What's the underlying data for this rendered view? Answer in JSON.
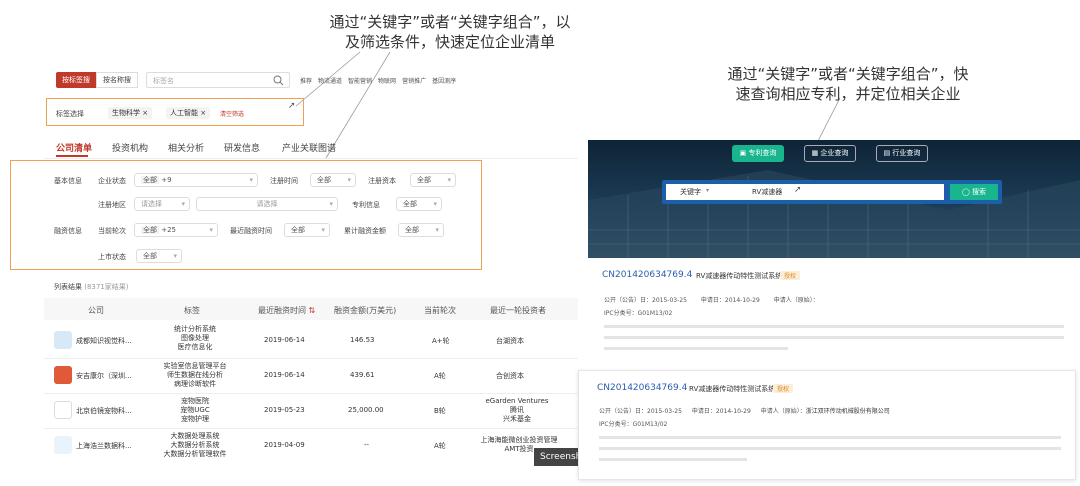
{
  "annotations": {
    "left": [
      "通过“关键字”或者“关键字组合”，以",
      "及筛选条件，快速定位企业清单"
    ],
    "right": [
      "通过“关键字”或者“关键字组合”，快",
      "速查询相应专利，并定位相关企业"
    ]
  },
  "left": {
    "search_tabs": [
      "按标签搜",
      "按名称搜"
    ],
    "search_placeholder": "标签名",
    "quick_links": [
      "推荐",
      "物流通道",
      "智能营销",
      "物联网",
      "营销推广",
      "基因测序"
    ],
    "tag_select_label": "标签选择",
    "tags": [
      "生物科学",
      "人工智能"
    ],
    "tag_clear": "清空筛选",
    "tabs": [
      "公司清单",
      "投资机构",
      "相关分析",
      "研发信息",
      "产业关联图谱"
    ],
    "filters": {
      "basic_info": "基本信息",
      "company_status": "企业状态",
      "status_value": "全部",
      "status_count": "+9",
      "reg_time": "注册时间",
      "reg_time_value": "全部",
      "reg_capital": "注册资本",
      "reg_capital_value": "全部",
      "reg_region": "注册地区",
      "region_placeholder_1": "请选择",
      "region_placeholder_2": "请选择",
      "patent_info": "专利信息",
      "patent_value": "全部",
      "financing_info": "融资信息",
      "current_round": "当前轮次",
      "round_value": "全部",
      "round_count": "+25",
      "recent_financing_time": "最近融资时间",
      "recent_time_value": "全部",
      "total_financing": "累计融资金额",
      "total_value": "全部",
      "listing_status": "上市状态",
      "listing_value": "全部"
    },
    "list_result": "列表结果",
    "list_count": "(8371家结果)",
    "table_headers": [
      "公司",
      "标签",
      "最近融资时间",
      "融资金额(万美元)",
      "当前轮次",
      "最近一轮投资者"
    ],
    "rows": [
      {
        "company": "成都知识视觉科...",
        "tags": [
          "统计分析系统",
          "图像处理",
          "医疗信息化"
        ],
        "date": "2019-06-14",
        "amount": "146.53",
        "round": "A+轮",
        "investors": [
          "台湖资本"
        ]
      },
      {
        "company": "安吉康尔（深圳...",
        "tags": [
          "实验室信息管理平台",
          "师生数据在线分析",
          "病理诊断软件"
        ],
        "date": "2019-06-14",
        "amount": "439.61",
        "round": "A轮",
        "investors": [
          "合创资本"
        ]
      },
      {
        "company": "北京伯镜宠物科...",
        "tags": [
          "宠物医院",
          "宠物UGC",
          "宠物护理"
        ],
        "date": "2019-05-23",
        "amount": "25,000.00",
        "round": "B轮",
        "investors": [
          "eGarden Ventures",
          "腾讯",
          "兴禾基金"
        ]
      },
      {
        "company": "上海浩兰数据科...",
        "tags": [
          "大数据处理系统",
          "大数据分析系统",
          "大数据分析管理软件"
        ],
        "date": "2019-04-09",
        "amount": "--",
        "round": "A轮",
        "investors": [
          "上海海能微创业投资管理",
          "AMT投资"
        ]
      }
    ],
    "screenshot_badge": "Screensh"
  },
  "right": {
    "tabs": [
      "专利查询",
      "企业查询",
      "行业查询"
    ],
    "search_type": "关键字",
    "search_value": "RV减速器",
    "search_button": "搜索",
    "results": [
      {
        "number": "CN201420634769.4",
        "title": "RV减速器传动特性测试系统",
        "badge": "授权",
        "meta_label_1": "公开（公告）日：",
        "meta_value_1": "2015-03-25",
        "meta_label_2": "申请日：",
        "meta_value_2": "2014-10-29",
        "meta_label_3": "申请人（原始）：",
        "meta_value_3": "",
        "ipc_label": "IPC分类号：",
        "ipc_value": "G01M13/02"
      },
      {
        "number": "CN201420634769.4",
        "title": "RV减速器传动特性测试系统",
        "badge": "授权",
        "meta_label_1": "公开（公告）日：",
        "meta_value_1": "2015-03-25",
        "meta_label_2": "申请日：",
        "meta_value_2": "2014-10-29",
        "meta_label_3": "申请人（原始）：",
        "meta_value_3": "浙江双环传动机械股份有限公司",
        "ipc_label": "IPC分类号：",
        "ipc_value": "G01M13/02"
      }
    ]
  },
  "colors": {
    "accent_red": "#c0392b",
    "orange_box": "#f0a050",
    "teal": "#19b58f",
    "blue_link": "#2a5db0"
  }
}
